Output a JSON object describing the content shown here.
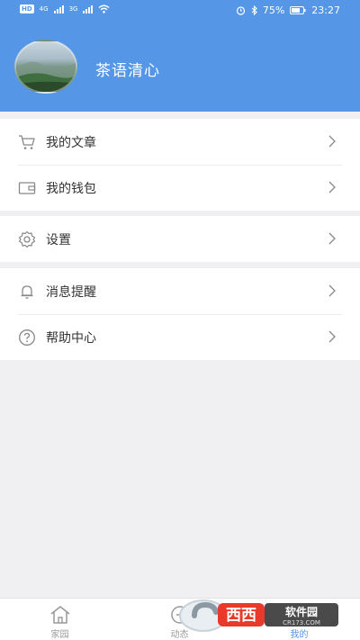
{
  "status_bar": {
    "network_chip": "HD",
    "signal_1": "4G",
    "signal_2": "3G",
    "battery": "75%",
    "time": "23:27"
  },
  "profile": {
    "username": "茶语清心"
  },
  "menu": {
    "group1": [
      {
        "label": "我的文章",
        "icon": "cart-icon"
      },
      {
        "label": "我的钱包",
        "icon": "wallet-icon"
      }
    ],
    "group2": [
      {
        "label": "设置",
        "icon": "gear-icon"
      }
    ],
    "group3": [
      {
        "label": "消息提醒",
        "icon": "bell-icon"
      },
      {
        "label": "帮助中心",
        "icon": "question-icon"
      }
    ]
  },
  "tabbar": {
    "tabs": [
      {
        "label": "家园",
        "icon": "home-icon",
        "active": false
      },
      {
        "label": "动态",
        "icon": "activity-icon",
        "active": false
      },
      {
        "label": "我的",
        "icon": "user-icon",
        "active": true
      }
    ]
  },
  "watermark": {
    "text": "西西软件园",
    "url_text": "CR173.COM"
  },
  "colors": {
    "header_bg": "#5597e6",
    "page_bg": "#f0f0f2",
    "text": "#333333",
    "icon": "#888888"
  }
}
